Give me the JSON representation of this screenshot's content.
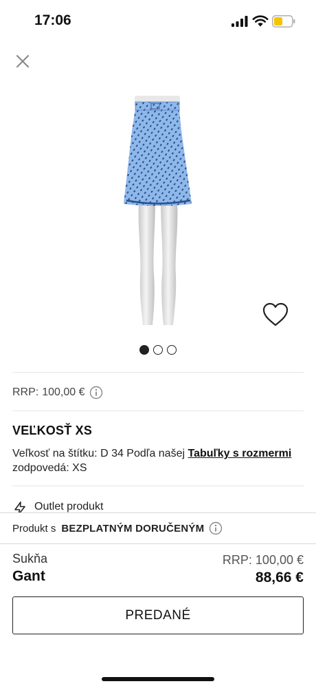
{
  "status_bar": {
    "time": "17:06",
    "signal_icon": "cellular-signal-icon",
    "wifi_icon": "wifi-icon",
    "battery_icon": "battery-low-icon",
    "battery_color": "#f5c400"
  },
  "header": {
    "close_icon": "close-icon"
  },
  "gallery": {
    "image_description_icon": "product-photo-skirt",
    "favorite_icon": "heart-outline-icon",
    "page_count": 3,
    "active_index": 0,
    "skirt_color": "#8fb8ea"
  },
  "rrp": {
    "label": "RRP:",
    "value": "100,00 €",
    "info_icon": "info-icon"
  },
  "size": {
    "heading": "VEĽKOSŤ XS",
    "text_before": "Veľkosť na štítku: D 34 Podľa našej ",
    "link": "Tabuľky s rozmermi",
    "text_after": " zodpovedá: XS"
  },
  "outlet": {
    "label": "Outlet produkt",
    "icon": "lightning-icon"
  },
  "delivery": {
    "prefix": "Produkt s",
    "strong": "BEZPLATNÝM DORUČENÝM",
    "info_icon": "info-icon"
  },
  "product": {
    "category": "Sukňa",
    "brand": "Gant",
    "rrp_label": "RRP:",
    "rrp_value": "100,00 €",
    "price": "88,66 €"
  },
  "actions": {
    "sold_label": "PREDANÉ"
  }
}
